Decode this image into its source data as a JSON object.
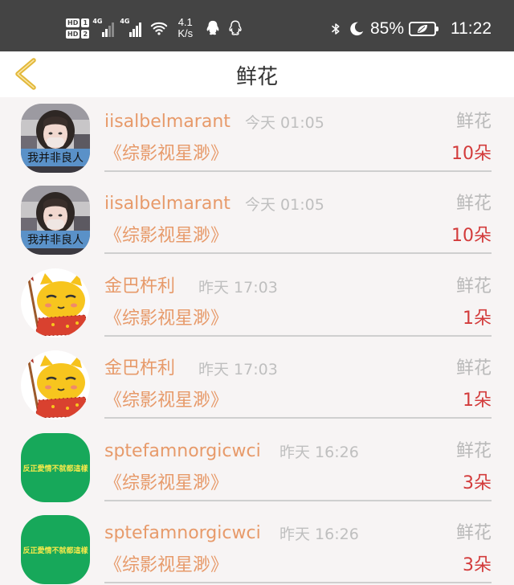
{
  "status_bar": {
    "hd1": "HD",
    "hd1_num": "1",
    "hd2": "HD",
    "hd2_num": "2",
    "sig1_label": "4G",
    "sig2_label": "4G",
    "speed_value": "4.1",
    "speed_unit": "K/s",
    "battery_percent": "85%",
    "time": "11:22"
  },
  "header": {
    "title": "鲜花"
  },
  "colors": {
    "accent_orange": "#e79a6a",
    "count_red": "#d33b3b",
    "status_bar_bg": "#444444",
    "back_arrow": "#e2b83a"
  },
  "records": [
    {
      "name": "iisalbelmarant",
      "time": "今天 01:05",
      "category": "鲜花",
      "book": "《综影视星渺》",
      "count": "10朵",
      "avatar_caption": "我并非良人",
      "avatar_type": "girl-photo"
    },
    {
      "name": "iisalbelmarant",
      "time": "今天 01:05",
      "category": "鲜花",
      "book": "《综影视星渺》",
      "count": "10朵",
      "avatar_caption": "我并非良人",
      "avatar_type": "girl-photo"
    },
    {
      "name": "金巴杵利",
      "time": "昨天 17:03",
      "category": "鲜花",
      "book": "《综影视星渺》",
      "count": "1朵",
      "avatar_caption": "",
      "avatar_type": "cartoon-cat"
    },
    {
      "name": "金巴杵利",
      "time": "昨天 17:03",
      "category": "鲜花",
      "book": "《综影视星渺》",
      "count": "1朵",
      "avatar_caption": "",
      "avatar_type": "cartoon-cat"
    },
    {
      "name": "sptefamnorgicwci",
      "time": "昨天 16:26",
      "category": "鲜花",
      "book": "《综影视星渺》",
      "count": "3朵",
      "avatar_caption": "反正愛情不就都這樣",
      "avatar_type": "green-text"
    },
    {
      "name": "sptefamnorgicwci",
      "time": "昨天 16:26",
      "category": "鲜花",
      "book": "《综影视星渺》",
      "count": "3朵",
      "avatar_caption": "反正愛情不就都這樣",
      "avatar_type": "green-text"
    }
  ]
}
